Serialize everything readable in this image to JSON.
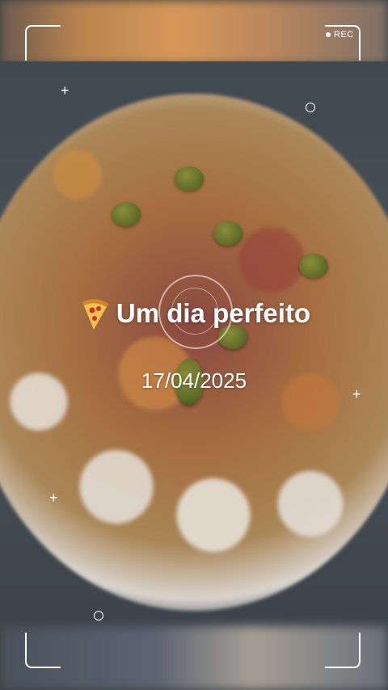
{
  "overlay": {
    "recording_label": "REC",
    "title": "Um dia perfeito",
    "title_icon": "pizza-icon",
    "date": "17/04/2025"
  },
  "colors": {
    "frame": "#ffffff",
    "text": "#ffffff"
  }
}
